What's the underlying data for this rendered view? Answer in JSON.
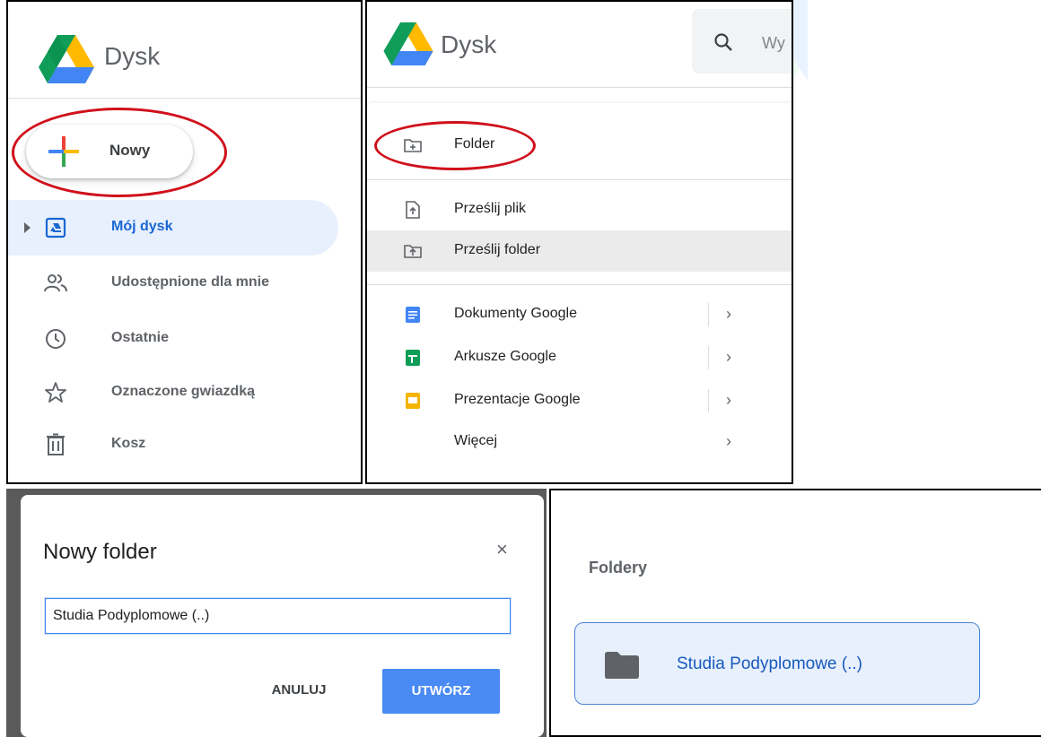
{
  "sidebar": {
    "app_title": "Dysk",
    "new_button_label": "Nowy",
    "items": [
      {
        "label": "Mój dysk",
        "icon": "my-drive-icon",
        "active": true
      },
      {
        "label": "Udostępnione dla mnie",
        "icon": "shared-people-icon",
        "active": false
      },
      {
        "label": "Ostatnie",
        "icon": "clock-icon",
        "active": false
      },
      {
        "label": "Oznaczone gwiazdką",
        "icon": "star-icon",
        "active": false
      },
      {
        "label": "Kosz",
        "icon": "trash-icon",
        "active": false
      }
    ]
  },
  "new_menu": {
    "app_title": "Dysk",
    "search_placeholder": "Wy",
    "items": [
      {
        "label": "Folder",
        "icon": "new-folder-icon"
      },
      {
        "label": "Prześlij plik",
        "icon": "upload-file-icon"
      },
      {
        "label": "Prześlij folder",
        "icon": "upload-folder-icon",
        "hover": true
      },
      {
        "label": "Dokumenty Google",
        "icon": "google-docs-icon",
        "submenu": true
      },
      {
        "label": "Arkusze Google",
        "icon": "google-sheets-icon",
        "submenu": true
      },
      {
        "label": "Prezentacje Google",
        "icon": "google-slides-icon",
        "submenu": true
      },
      {
        "label": "Więcej",
        "icon": "",
        "submenu": true
      }
    ],
    "chevron": "›"
  },
  "dialog": {
    "title": "Nowy folder",
    "close_symbol": "×",
    "input_value": "Studia Podyplomowe (..)",
    "cancel_label": "ANULUJ",
    "create_label": "UTWÓRZ"
  },
  "folders": {
    "section_label": "Foldery",
    "items": [
      {
        "name": "Studia Podyplomowe (..)",
        "icon": "folder-icon",
        "selected": true
      }
    ]
  },
  "colors": {
    "accent_blue": "#1967d2",
    "create_button": "#4a8af4",
    "highlight_ellipse": "#d0101b",
    "active_nav_bg": "#e8f0fe"
  }
}
